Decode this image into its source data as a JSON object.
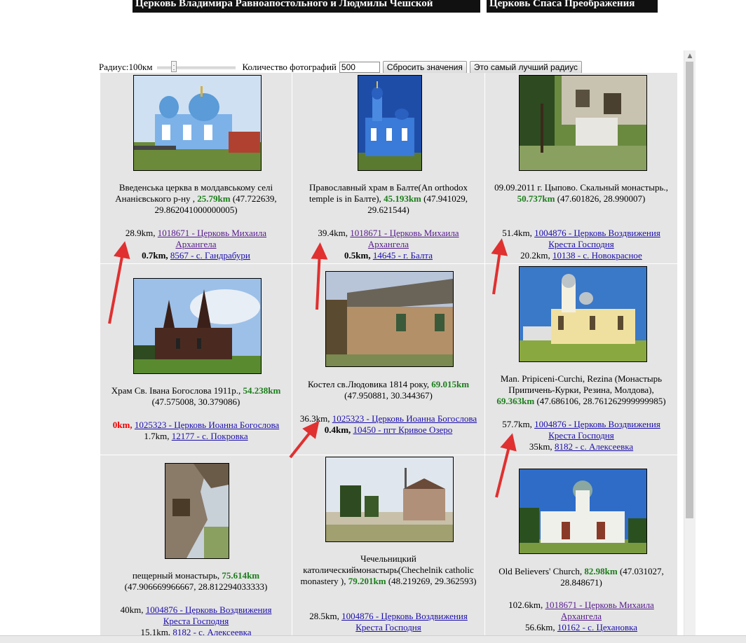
{
  "top": {
    "btn1": "Церковь Владимира Равноапостольного и Людмилы Чешской",
    "btn2": "Церковь Спаса Преображения"
  },
  "controls": {
    "radius_label": "Радиус:100км",
    "count_label": "Количество фотографий",
    "count_value": "500",
    "reset_label": "Сбросить значения",
    "best_label": "Это самый лучший радиус"
  },
  "cells": [
    {
      "caption_pre": "Введенська церква в молдавському селі Ананієвського р-ну ,",
      "distance": "25.79km",
      "coords": "(47.722639, 29.862041000000005)",
      "link1_dist": "28.9km,",
      "link1_text": "1018671 - Церковь Михаила Архангела",
      "link2_dist": "0.7km,",
      "link2_text": "8567 - с. Гандрабури"
    },
    {
      "caption_pre": "Православный храм в Балте(An orthodox temple is in Балте),",
      "distance": "45.193km",
      "coords": "(47.941029, 29.621544)",
      "link1_dist": "39.4km,",
      "link1_text": "1018671 - Церковь Михаила Архангела",
      "link2_dist": "0.5km,",
      "link2_text": "14645 - г. Балта"
    },
    {
      "caption_pre": "09.09.2011 г. Цыпово. Скальный монастырь.,",
      "distance": "50.737km",
      "coords": "(47.601826, 28.990007)",
      "link1_dist": "51.4km,",
      "link1_text": "1004876 - Церковь Воздвижения Креста Господня",
      "link2_dist": "20.2km,",
      "link2_text": "10138 - с. Новокрасное"
    },
    {
      "caption_pre": "Храм Св. Івана Богослова 1911р.,",
      "distance": "54.238km",
      "coords": "(47.575008, 30.379086)",
      "link1_dist": "0km,",
      "link1_text": "1025323 - Церковь Иоанна Богослова",
      "link2_dist": "1.7km,",
      "link2_text": "12177 - с. Покровка"
    },
    {
      "caption_pre": "Костел св.Людовика 1814 року,",
      "distance": "69.015km",
      "coords": "(47.950881, 30.344367)",
      "link1_dist": "36.3km,",
      "link1_text": "1025323 - Церковь Иоанна Богослова",
      "link2_dist": "0.4km,",
      "link2_text": "10450 - пгт Кривое Озеро"
    },
    {
      "caption_pre": "Man. Pripiceni-Curchi, Rezina (Монастырь Припичень-Курки, Резина, Молдова),",
      "distance": "69.363km",
      "coords": "(47.686106, 28.761262999999985)",
      "link1_dist": "57.7km,",
      "link1_text": "1004876 - Церковь Воздвижения Креста Господня",
      "link2_dist": "35km,",
      "link2_text": "8182 - с. Алексеевка"
    },
    {
      "caption_pre": "пещерный монастырь,",
      "distance": "75.614km",
      "coords": "(47.906669966667, 28.812294033333)",
      "link1_dist": "40km,",
      "link1_text": "1004876 - Церковь Воздвижения Креста Господня",
      "link2_dist": "15.1km,",
      "link2_text": "8182 - с. Алексеевка"
    },
    {
      "caption_pre": "Чечельницкий католическиймонастырь(Chechelnik catholic monastery ),",
      "distance": "79.201km",
      "coords": "(48.219269, 29.362593)",
      "link1_dist": "28.5km,",
      "link1_text": "1004876 - Церковь Воздвижения Креста Господня",
      "link2_dist": "",
      "link2_text": ""
    },
    {
      "caption_pre": "Old Believers' Church,",
      "distance": "82.98km",
      "coords": "(47.031027, 28.848671)",
      "link1_dist": "102.6km,",
      "link1_text": "1018671 - Церковь Михаила Архангела",
      "link2_dist": "56.6km,",
      "link2_text": "10162 - с. Цехановка"
    }
  ],
  "colors": {
    "distance_green": "#1b7d1b",
    "arrow_red": "#e03030",
    "zero_red": "#e00000"
  }
}
